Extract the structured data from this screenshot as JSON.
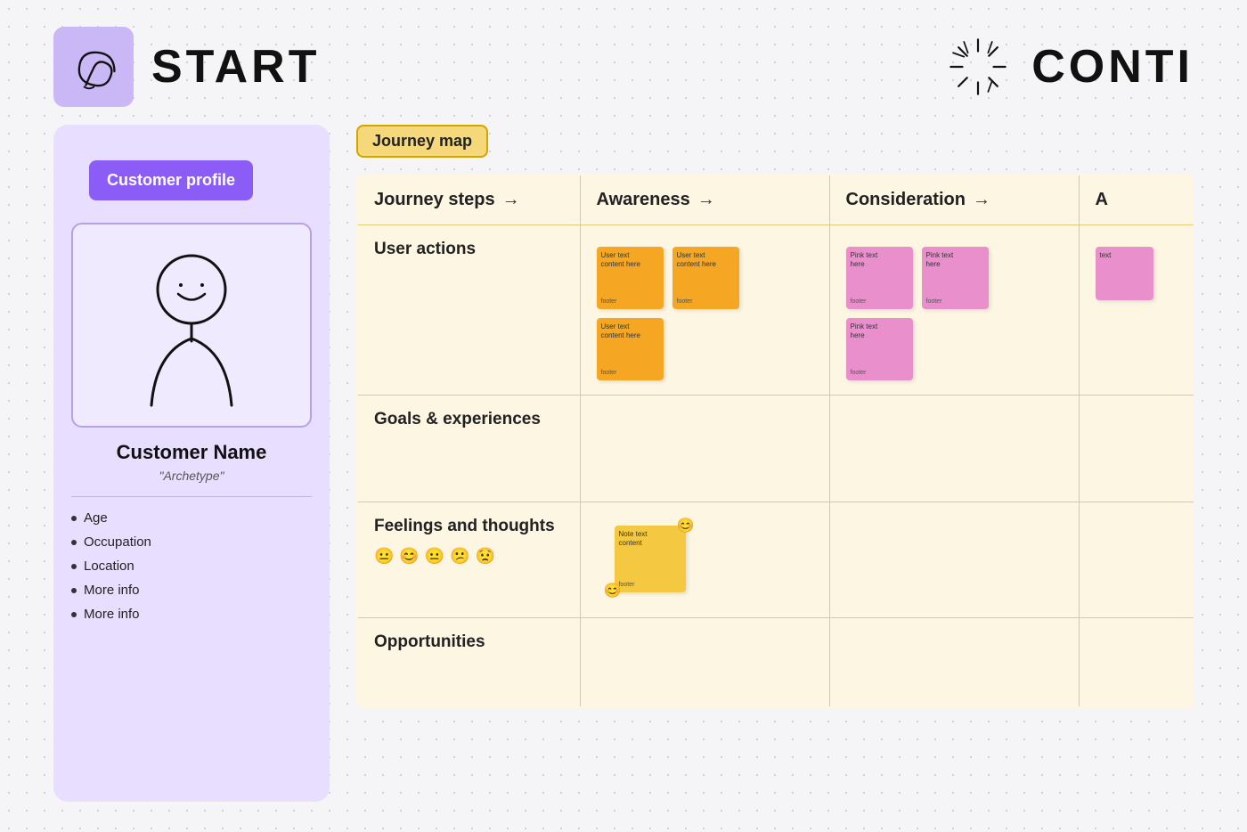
{
  "header": {
    "start_label": "START",
    "continue_label": "CONTI"
  },
  "customer_profile": {
    "header_label": "Customer profile",
    "name": "Customer Name",
    "archetype": "\"Archetype\"",
    "list_items": [
      "Age",
      "Occupation",
      "Location",
      "More info",
      "More info"
    ]
  },
  "journey_map": {
    "badge_label": "Journey map",
    "columns": [
      {
        "id": "steps",
        "label": "Journey steps",
        "has_arrow": true
      },
      {
        "id": "awareness",
        "label": "Awareness",
        "has_arrow": true
      },
      {
        "id": "consideration",
        "label": "Consideration",
        "has_arrow": true
      },
      {
        "id": "action",
        "label": "A",
        "has_arrow": false
      }
    ],
    "rows": [
      {
        "id": "user-actions",
        "label": "User actions",
        "cells": {
          "awareness": {
            "notes": [
              {
                "color": "orange",
                "line1": "User text",
                "footer": "footer"
              },
              {
                "color": "orange",
                "line1": "User text",
                "footer": "footer"
              },
              {
                "color": "orange",
                "line1": "User text",
                "footer": "footer"
              }
            ]
          },
          "consideration": {
            "notes": [
              {
                "color": "pink",
                "line1": "Pink text",
                "footer": "footer"
              },
              {
                "color": "pink",
                "line1": "Pink text",
                "footer": "footer"
              },
              {
                "color": "pink",
                "line1": "Pink text",
                "footer": "footer"
              }
            ]
          },
          "action": {
            "notes": [
              {
                "color": "pink",
                "line1": "text",
                "footer": ""
              }
            ]
          }
        }
      },
      {
        "id": "goals-experiences",
        "label": "Goals & experiences",
        "cells": {
          "awareness": {
            "notes": []
          },
          "consideration": {
            "notes": []
          },
          "action": {
            "notes": []
          }
        }
      },
      {
        "id": "feelings-thoughts",
        "label": "Feelings and thoughts",
        "emojis": [
          "😐",
          "😊",
          "😐",
          "😕",
          "😟"
        ],
        "cells": {
          "awareness": {
            "special": true,
            "notes": [
              {
                "color": "yellow",
                "line1": "Note text",
                "footer": "footer"
              }
            ],
            "has_emoji_left": true,
            "has_emoji_right": true
          },
          "consideration": {
            "notes": []
          },
          "action": {
            "notes": []
          }
        }
      },
      {
        "id": "opportunities",
        "label": "Opportunities",
        "cells": {
          "awareness": {
            "notes": []
          },
          "consideration": {
            "notes": []
          },
          "action": {
            "notes": []
          }
        }
      }
    ]
  }
}
